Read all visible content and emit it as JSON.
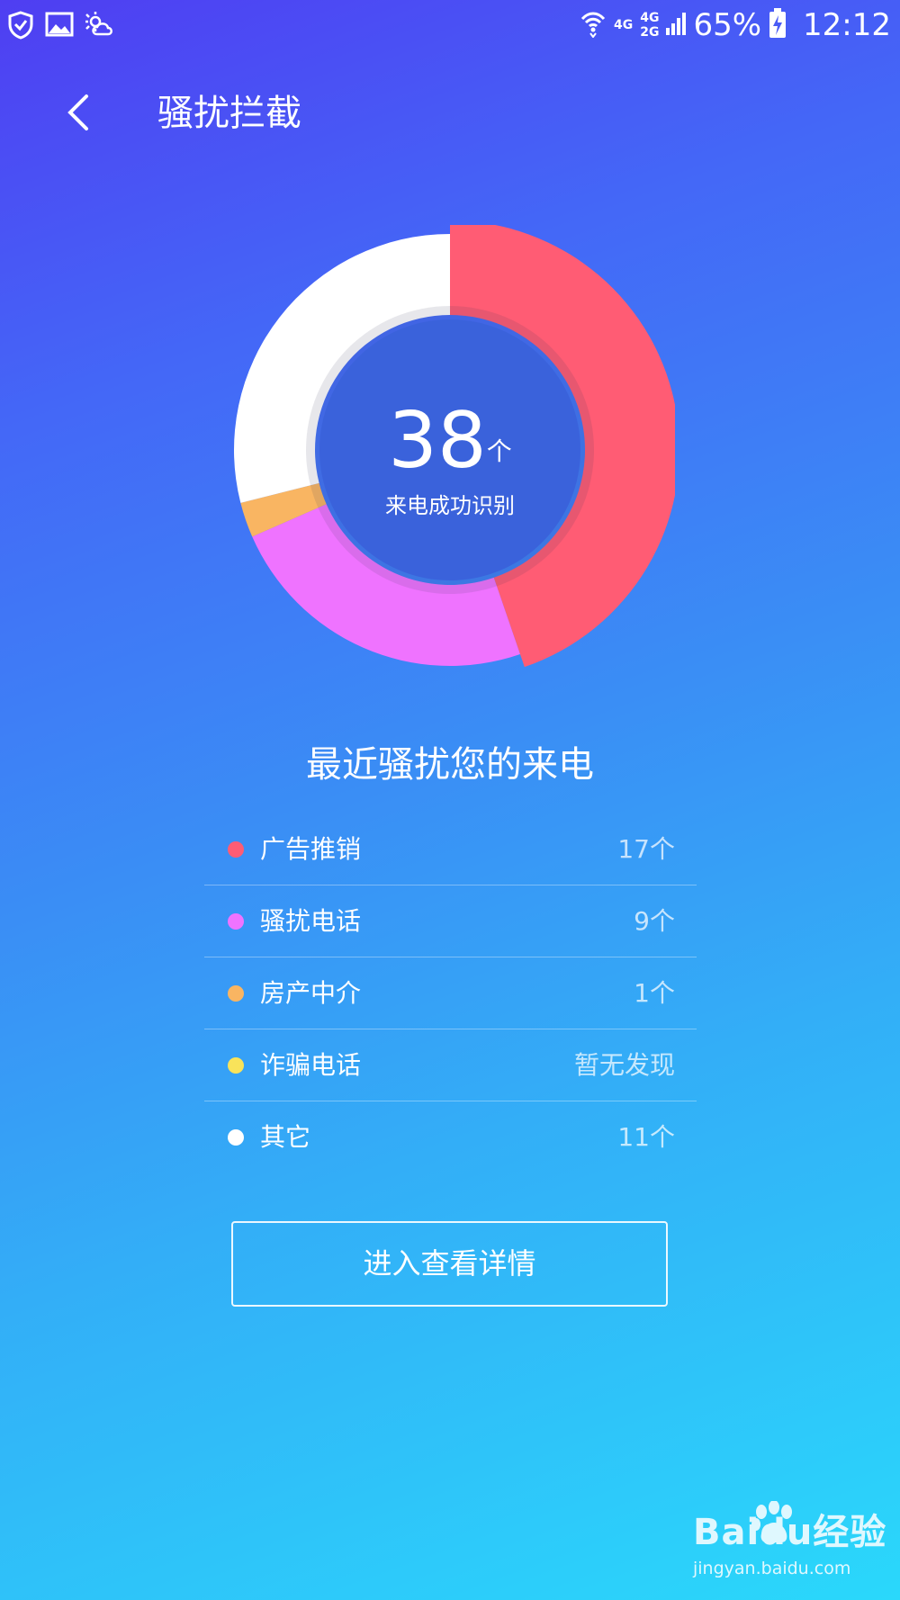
{
  "status_bar": {
    "left_icons": [
      "shield-check-icon",
      "gallery-icon",
      "weather-icon"
    ],
    "network_primary": "4G",
    "network_secondary_top": "4G",
    "network_secondary_bottom": "2G",
    "battery": "65%",
    "time": "12:12"
  },
  "header": {
    "back_icon": "chevron-left-icon",
    "title": "骚扰拦截"
  },
  "summary": {
    "count": "38",
    "unit": "个",
    "label": "来电成功识别"
  },
  "chart_data": {
    "type": "pie",
    "style": "donut",
    "total": 38,
    "categories": [
      "广告推销",
      "骚扰电话",
      "房产中介",
      "诈骗电话",
      "其它"
    ],
    "values": [
      17,
      9,
      1,
      0,
      11
    ],
    "colors": [
      "#ff5c74",
      "#ef73ff",
      "#f9b562",
      "#f9e35a",
      "#ffffff"
    ],
    "highlighted": "广告推销"
  },
  "recent": {
    "title": "最近骚扰您的来电",
    "items": [
      {
        "name": "广告推销",
        "value": "17个",
        "color": "#ff5c74"
      },
      {
        "name": "骚扰电话",
        "value": "9个",
        "color": "#ef73ff"
      },
      {
        "name": "房产中介",
        "value": "1个",
        "color": "#f9b562"
      },
      {
        "name": "诈骗电话",
        "value": "暂无发现",
        "color": "#f9e35a"
      },
      {
        "name": "其它",
        "value": "11个",
        "color": "#ffffff"
      }
    ]
  },
  "actions": {
    "detail_label": "进入查看详情"
  },
  "watermark": {
    "brand": "Baidu经验",
    "url": "jingyan.baidu.com"
  }
}
